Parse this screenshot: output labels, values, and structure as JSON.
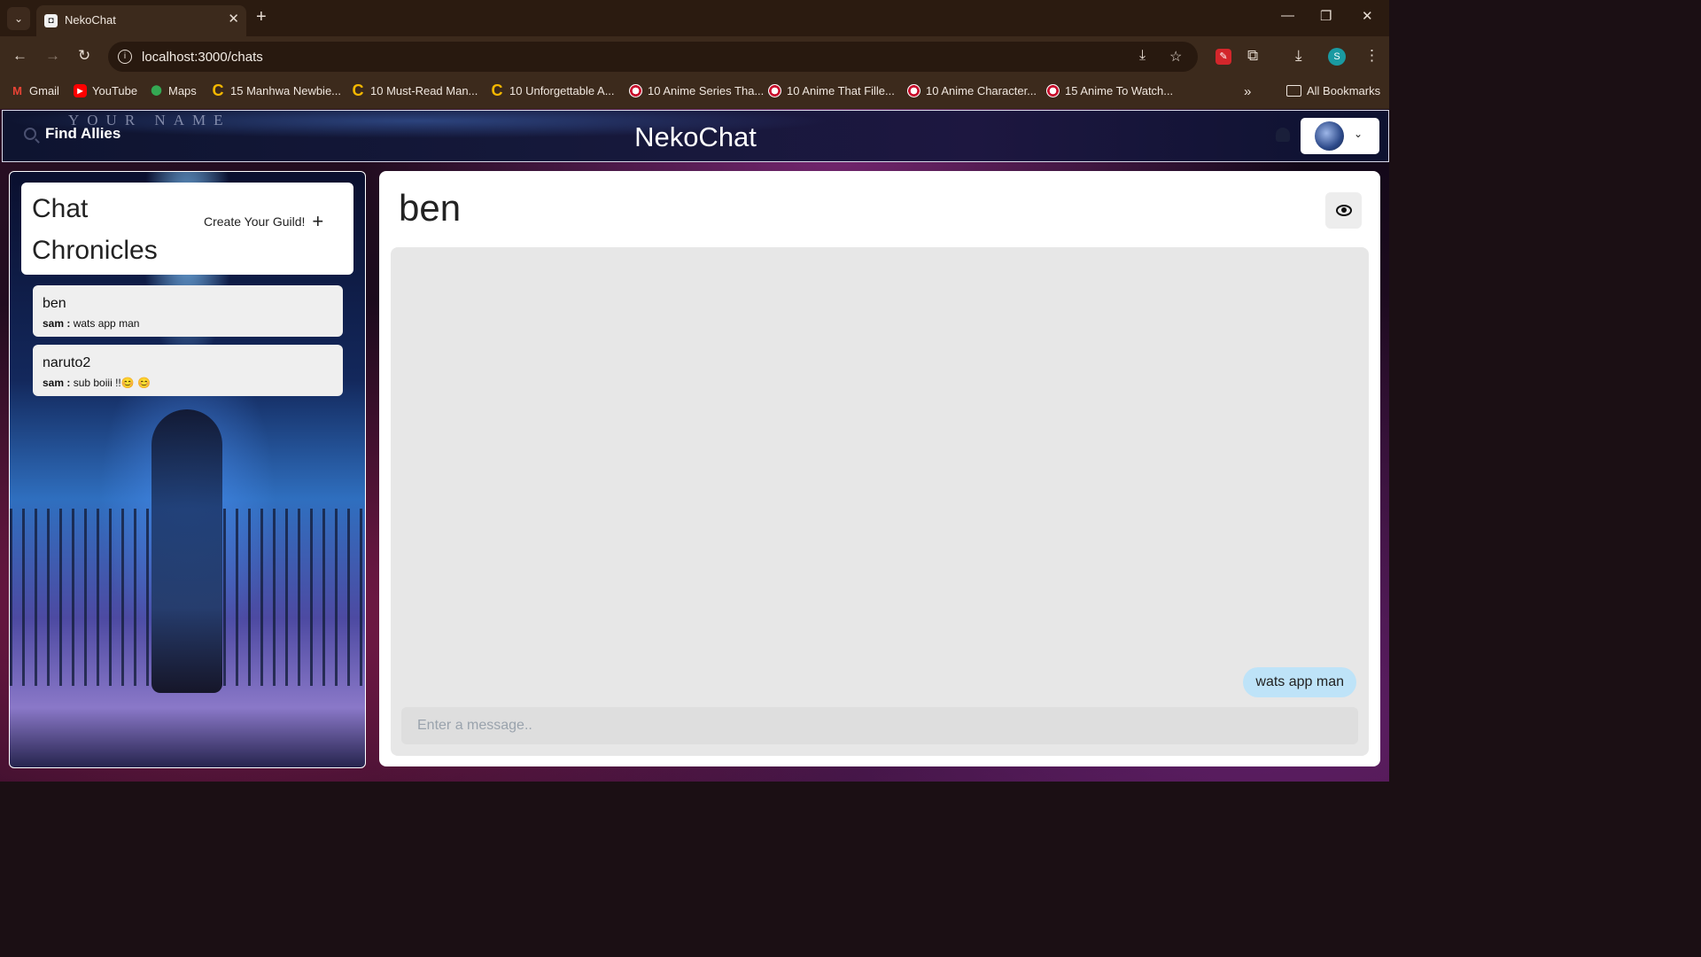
{
  "browser": {
    "tab_title": "NekoChat",
    "url": "localhost:3000/chats",
    "profile_initial": "S",
    "bookmarks": [
      {
        "label": "Gmail",
        "icon": "gmail-icon"
      },
      {
        "label": "YouTube",
        "icon": "youtube-icon"
      },
      {
        "label": "Maps",
        "icon": "maps-icon"
      },
      {
        "label": "15 Manhwa Newbie...",
        "icon": "c-icon"
      },
      {
        "label": "10 Must-Read Man...",
        "icon": "c-icon"
      },
      {
        "label": "10 Unforgettable A...",
        "icon": "c-icon"
      },
      {
        "label": "10 Anime Series Tha...",
        "icon": "anime-site-icon"
      },
      {
        "label": "10 Anime That Fille...",
        "icon": "anime-site-icon"
      },
      {
        "label": "10 Anime Character...",
        "icon": "anime-site-icon"
      },
      {
        "label": "15 Anime To Watch...",
        "icon": "anime-site-icon"
      }
    ],
    "all_bookmarks": "All Bookmarks"
  },
  "header": {
    "find_allies": "Find Allies",
    "watermark": "YOUR NAME",
    "brand": "NekoChat"
  },
  "sidebar": {
    "title": "Chat Chronicles",
    "create_guild": "Create Your Guild!",
    "chats": [
      {
        "name": "ben",
        "sender": "sam :",
        "preview": "wats app man"
      },
      {
        "name": "naruto2",
        "sender": "sam :",
        "preview": "sub boiii !!😊 😊"
      }
    ]
  },
  "chat": {
    "title": "ben",
    "messages": [
      {
        "text": "wats app man"
      }
    ],
    "input_placeholder": "Enter a message.."
  }
}
